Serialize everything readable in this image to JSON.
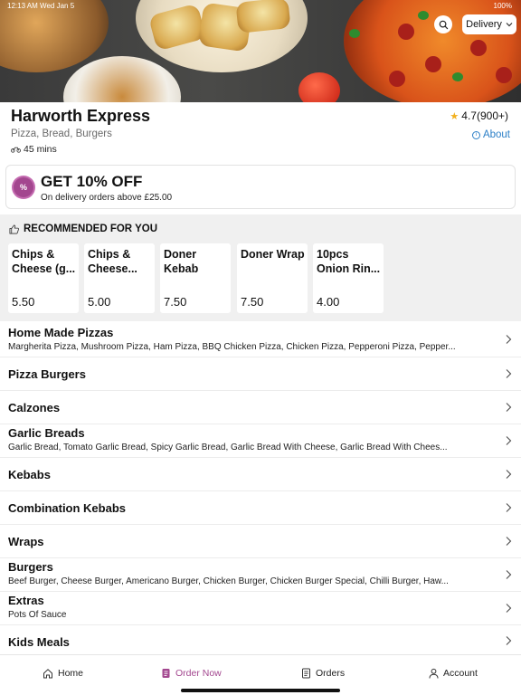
{
  "status_bar": {
    "time": "12:13 AM",
    "date": "Wed Jan 5",
    "battery": "100%"
  },
  "top_actions": {
    "delivery_label": "Delivery"
  },
  "store": {
    "name": "Harworth Express",
    "rating": "4.7(900+)",
    "cuisine": "Pizza, Bread, Burgers",
    "eta": "45 mins",
    "about_label": "About"
  },
  "promo": {
    "title": "GET 10% OFF",
    "subtitle": "On delivery orders above £25.00",
    "badge": "%"
  },
  "recommended": {
    "title": "RECOMMENDED FOR YOU",
    "items": [
      {
        "name": "Chips & Cheese (g...",
        "price": "5.50"
      },
      {
        "name": "Chips & Cheese...",
        "price": "5.00"
      },
      {
        "name": "Doner Kebab",
        "price": "7.50"
      },
      {
        "name": "Doner Wrap",
        "price": "7.50"
      },
      {
        "name": "10pcs Onion Rin...",
        "price": "4.00"
      }
    ]
  },
  "menu": [
    {
      "name": "Home Made Pizzas",
      "desc": "Margherita Pizza, Mushroom Pizza, Ham Pizza, BBQ Chicken Pizza, Chicken Pizza, Pepperoni Pizza, Pepper..."
    },
    {
      "name": "Pizza Burgers",
      "desc": ""
    },
    {
      "name": "Calzones",
      "desc": ""
    },
    {
      "name": "Garlic Breads",
      "desc": "Garlic Bread, Tomato Garlic Bread, Spicy Garlic Bread, Garlic Bread With Cheese, Garlic Bread With Chees..."
    },
    {
      "name": "Kebabs",
      "desc": ""
    },
    {
      "name": "Combination Kebabs",
      "desc": ""
    },
    {
      "name": "Wraps",
      "desc": ""
    },
    {
      "name": "Burgers",
      "desc": "Beef Burger, Cheese Burger, Americano Burger, Chicken Burger, Chicken Burger Special, Chilli Burger, Haw..."
    },
    {
      "name": "Extras",
      "desc": "Pots Of Sauce"
    },
    {
      "name": "Kids Meals",
      "desc": ""
    }
  ],
  "bottom_nav": {
    "home": "Home",
    "order_now": "Order Now",
    "orders": "Orders",
    "account": "Account"
  },
  "colors": {
    "accent": "#a3478f",
    "link": "#2b7fc7",
    "star": "#f2b01e"
  }
}
